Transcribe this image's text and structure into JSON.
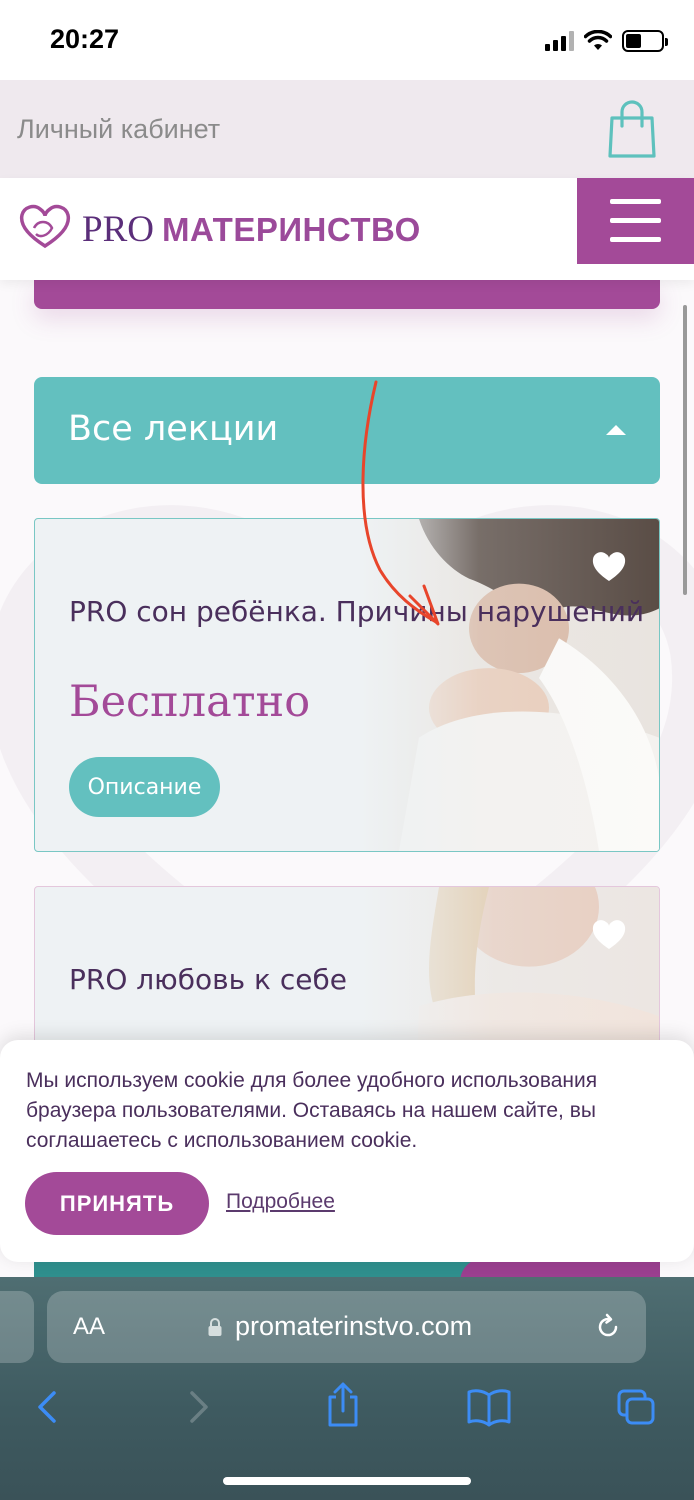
{
  "status_bar": {
    "time": "20:27"
  },
  "top_bar": {
    "cabinet_label": "Личный кабинет"
  },
  "header": {
    "logo_pro": "PRO",
    "logo_word": "МАТЕРИНСТВО"
  },
  "lectures": {
    "toggle_label": "Все лекции",
    "cards": [
      {
        "title": "PRO сон ребёнка. Причины нарушений",
        "price": "Бесплатно",
        "button": "Описание"
      },
      {
        "title": "PRO любовь к себе"
      }
    ]
  },
  "cookie": {
    "text": "Мы используем cookie для более удобного использования браузера пользователями. Оставаясь на нашем сайте, вы соглашаетесь с использованием cookie.",
    "accept": "ПРИНЯТЬ",
    "more": "Подробнее"
  },
  "browser": {
    "text_size_label": "AA",
    "url": "promaterinstvo.com"
  },
  "colors": {
    "teal": "#63c0bf",
    "purple": "#a34a98",
    "dark_purple": "#4a2f5c"
  },
  "icons": [
    "signal-icon",
    "wifi-icon",
    "battery-icon",
    "shopping-bag-icon",
    "logo-heart-icon",
    "menu-icon",
    "caret-up-icon",
    "favorite-heart-icon",
    "lock-icon",
    "reload-icon",
    "back-icon",
    "forward-icon",
    "share-icon",
    "bookmarks-icon",
    "tabs-icon"
  ]
}
